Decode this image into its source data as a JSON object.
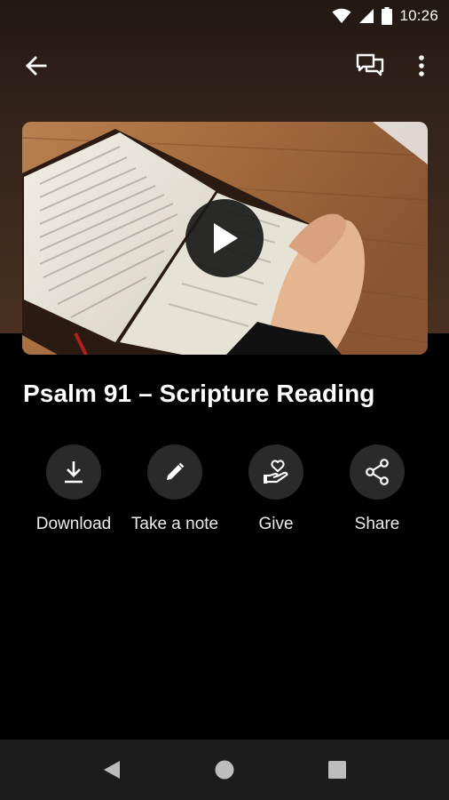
{
  "status_bar": {
    "time": "10:26",
    "icons": [
      "wifi-icon",
      "signal-icon",
      "battery-icon"
    ]
  },
  "app_bar": {
    "icons": [
      "back-arrow-icon",
      "chat-icon",
      "more-vert-icon"
    ]
  },
  "media": {
    "thumbnail": "open bible on wooden table",
    "play_icon": "play-icon"
  },
  "title": "Psalm 91 – Scripture Reading",
  "actions": [
    {
      "label": "Download",
      "icon": "download-icon"
    },
    {
      "label": "Take a note",
      "icon": "pencil-icon"
    },
    {
      "label": "Give",
      "icon": "give-hand-heart-icon"
    },
    {
      "label": "Share",
      "icon": "share-icon"
    }
  ],
  "nav_bar": {
    "icons": [
      "back-triangle-icon",
      "home-circle-icon",
      "recents-square-icon"
    ]
  },
  "colors": {
    "background": "#000000",
    "header_gradient": "#3f2a1d",
    "action_circle": "#2a2a2a",
    "nav_bar": "#1c1c1c",
    "text": "#ffffff"
  }
}
